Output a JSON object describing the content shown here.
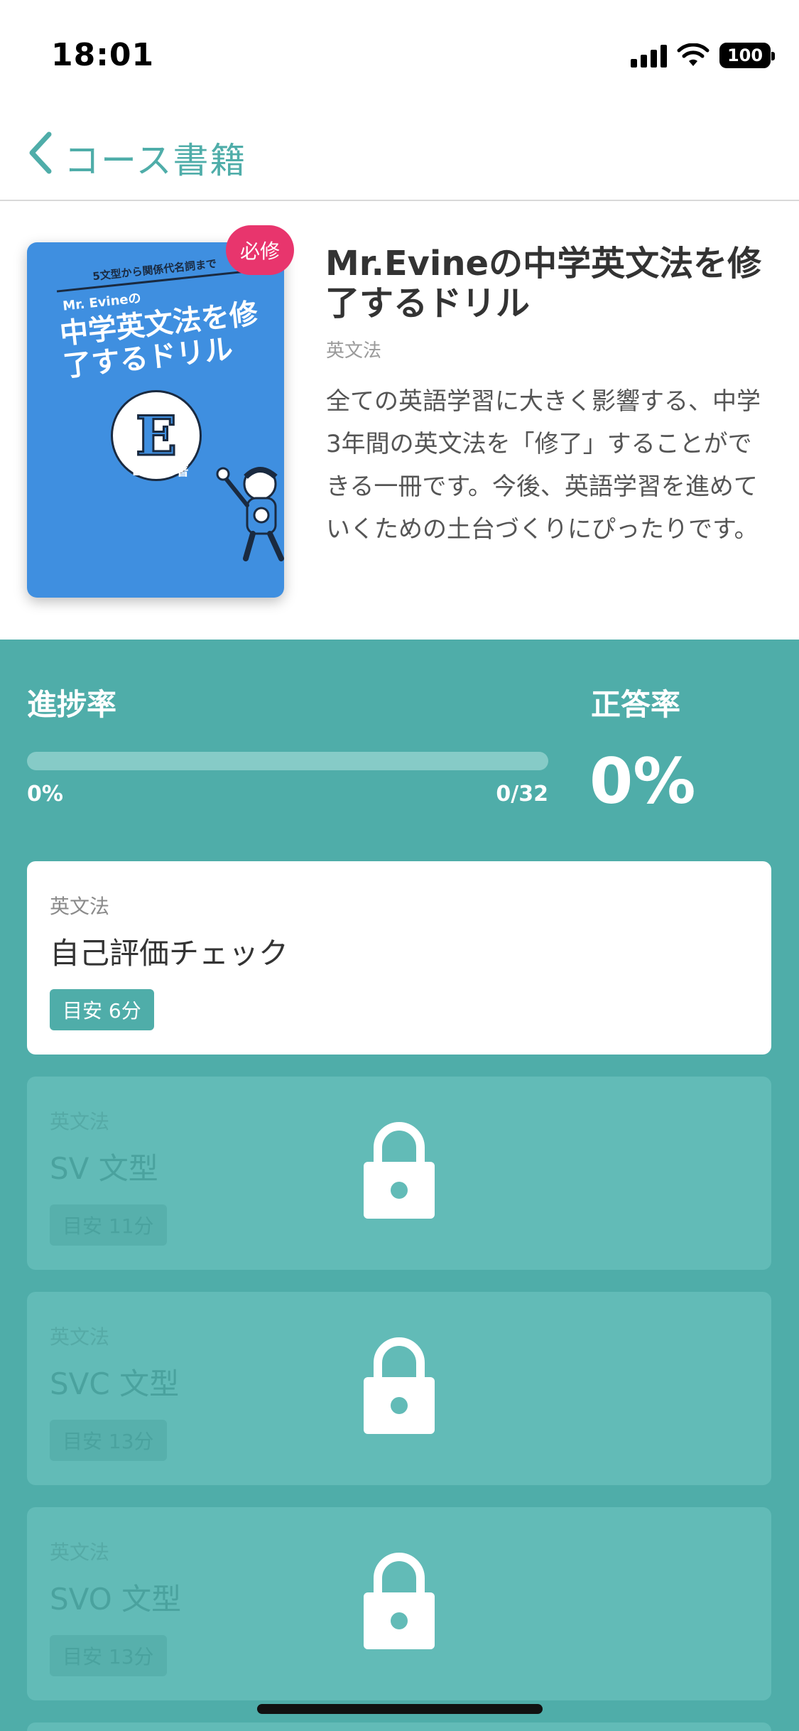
{
  "status_bar": {
    "time": "18:01",
    "battery": "100",
    "icons": [
      "cellular-signal-icon",
      "wifi-icon",
      "battery-icon"
    ]
  },
  "nav": {
    "back_icon": "chevron-left-icon",
    "title": "コース書籍"
  },
  "book": {
    "badge": "必修",
    "title": "Mr.Evineの中学英文法を修了するドリル",
    "category": "英文法",
    "description": "全ての英語学習に大きく影響する、中学3年間の英文法を「修了」することができる一冊です。今後、英語学習を進めていくための土台づくりにぴったりです。",
    "cover": {
      "subtitle": "5文型から関係代名詞まで",
      "author_line": "Mr. Evineの",
      "title": "中学英文法を修了するドリル",
      "logo_letter": "E",
      "author": "Evine 著"
    }
  },
  "stats": {
    "progress_label": "進捗率",
    "progress_percent": "0%",
    "progress_fraction": 0,
    "progress_count": "0/32",
    "accuracy_label": "正答率",
    "accuracy_value": "0%"
  },
  "lessons": [
    {
      "category": "英文法",
      "name": "自己評価チェック",
      "time": "目安 6分",
      "locked": false
    },
    {
      "category": "英文法",
      "name": "SV 文型",
      "time": "目安 11分",
      "locked": true
    },
    {
      "category": "英文法",
      "name": "SVC 文型",
      "time": "目安 13分",
      "locked": true
    },
    {
      "category": "英文法",
      "name": "SVO 文型",
      "time": "目安 13分",
      "locked": true
    }
  ],
  "colors": {
    "accent": "#4FADA9",
    "badge": "#E8356D",
    "cover": "#3F8FE0"
  }
}
